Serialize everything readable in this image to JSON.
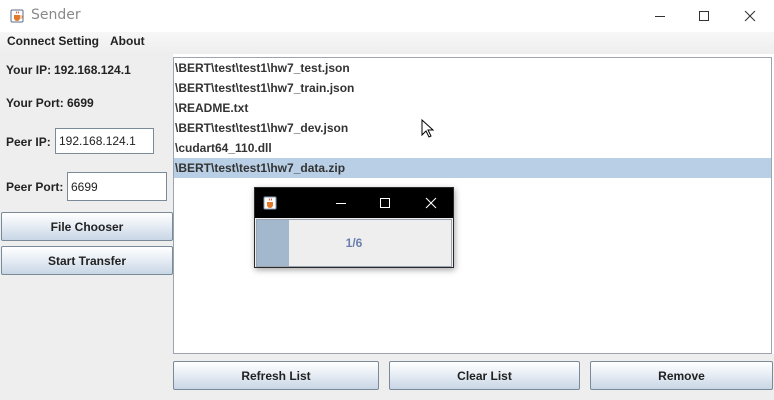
{
  "window": {
    "title": "Sender",
    "icon": "java-cup-icon",
    "controls": [
      "minimize-icon",
      "maximize-icon",
      "close-icon"
    ]
  },
  "menubar": {
    "items": [
      "Connect Setting",
      "About"
    ]
  },
  "left_panel": {
    "your_ip_label": "Your IP:",
    "your_ip_value": "192.168.124.1",
    "your_port_label": "Your Port:",
    "your_port_value": "6699",
    "peer_ip_label": "Peer IP:",
    "peer_ip_value": "192.168.124.1",
    "peer_port_label": "Peer Port:",
    "peer_port_value": "6699",
    "file_chooser_label": "File Chooser",
    "start_transfer_label": "Start Transfer"
  },
  "file_list": {
    "items": [
      "\\BERT\\test\\test1\\hw7_test.json",
      "\\BERT\\test\\test1\\hw7_train.json",
      "\\README.txt",
      "\\BERT\\test\\test1\\hw7_dev.json",
      "\\cudart64_110.dll",
      "\\BERT\\test\\test1\\hw7_data.zip"
    ],
    "selected_index": 5
  },
  "bottom_buttons": {
    "refresh_label": "Refresh List",
    "clear_label": "Clear List",
    "remove_label": "Remove"
  },
  "progress_dialog": {
    "icon": "java-cup-icon",
    "controls": [
      "minimize-icon",
      "maximize-icon",
      "close-icon"
    ],
    "progress_text": "1/6",
    "progress_fraction": 0.1667
  },
  "colors": {
    "selection": "#b8cfe5",
    "progress_fill": "#a3b8cc",
    "progress_text": "#6b7fae",
    "dialog_titlebar": "#000000"
  }
}
